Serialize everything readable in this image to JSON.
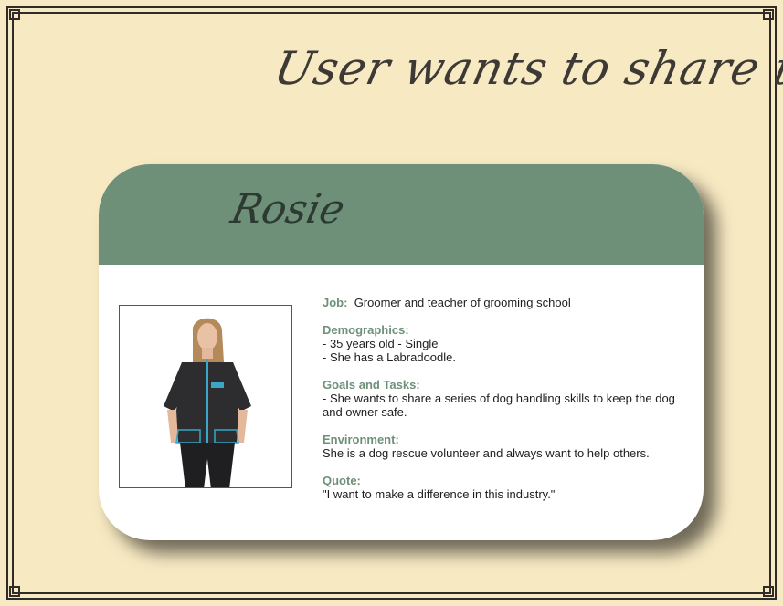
{
  "headline": "User wants to share tips",
  "persona": {
    "name": "Rosie",
    "job_label": "Job:",
    "job_value": "Groomer and teacher of grooming school",
    "demographics_label": "Demographics:",
    "demographics_lines": [
      "- 35 years old - Single",
      "- She has a Labradoodle."
    ],
    "goals_label": "Goals and Tasks:",
    "goals_text": "- She wants to share a series of dog handling skills to keep the dog and owner safe.",
    "environment_label": "Environment:",
    "environment_text": "She is a dog rescue volunteer and always want to help others.",
    "quote_label": "Quote:",
    "quote_text": "\"I want to make a difference in this industry.\""
  },
  "colors": {
    "background": "#f7e9c2",
    "header_green": "#6e9079",
    "frame": "#2f2b28"
  }
}
